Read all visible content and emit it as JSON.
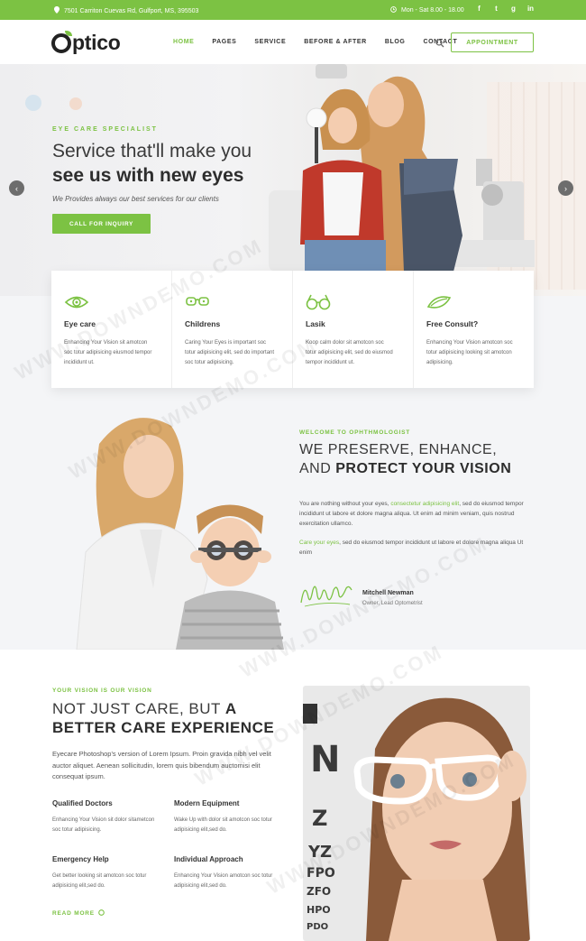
{
  "topbar": {
    "address": "7501 Carriton Cuevas Rd, Gulfport, MS, 395503",
    "hours": "Mon - Sat 8.00 - 18.00",
    "socials": [
      "f",
      "t",
      "g",
      "in"
    ]
  },
  "header": {
    "logo_text": "ptico",
    "nav": [
      "HOME",
      "PAGES",
      "SERVICE",
      "BEFORE & AFTER",
      "BLOG",
      "CONTACT"
    ],
    "active_nav": "HOME",
    "appointment_label": "APPOINTMENT"
  },
  "hero": {
    "kicker": "EYE CARE SPECIALIST",
    "title_line1": "Service that'll make you",
    "title_line2": "see us with new eyes",
    "subtitle": "We Provides always our best services for our clients",
    "button_label": "CALL FOR INQUIRY",
    "prev_glyph": "‹",
    "next_glyph": "›"
  },
  "services": [
    {
      "title": "Eye care",
      "desc": "Enhancing Your Vision sit amotcon soc totur adipisicing eiusmod tempor incididunt ut.",
      "icon": "eye-icon"
    },
    {
      "title": "Childrens",
      "desc": "Caring Your Eyes is important soc totur adipisicing elit, sed do important soc totur adipisicing.",
      "icon": "kids-glasses-icon"
    },
    {
      "title": "Lasik",
      "desc": "Koop calm dolor sit amotcon soc totur adipisicing elit, sed do eiusmod tempor incididunt ut.",
      "icon": "glasses-icon"
    },
    {
      "title": "Free Consult?",
      "desc": "Enhancing Your Vision amotcon soc totur adipisicing looking sit amotcon adipisicing.",
      "icon": "contact-lens-icon"
    }
  ],
  "about": {
    "kicker": "WELCOME TO OPHTHMOLOGIST",
    "heading_line1": "WE PRESERVE, ENHANCE,",
    "heading_line2_prefix": "AND ",
    "heading_line2_bold": "PROTECT YOUR VISION",
    "p1_prefix": "You are nothing without your eyes, ",
    "p1_link": "consectetur adipisicing elit",
    "p1_suffix": ", sed do eiusmod tempor incididunt ut labore et dolore magna aliqua. Ut enim ad minim veniam, quis nostrud exercitation ullamco.",
    "p2_link": "Care your eyes",
    "p2_suffix": ", sed do eiusmod tempor incididunt ut labore et dolore magna aliqua Ut enim",
    "sig_name": "Mitchell Newman",
    "sig_role": "Owner, Lead Optometrist"
  },
  "vision": {
    "kicker": "YOUR VISION IS OUR VISION",
    "heading_line1": "NOT JUST CARE, BUT ",
    "heading_line1_bold": "A",
    "heading_line2": "BETTER CARE EXPERIENCE",
    "paragraph": "Eyecare Photoshop's version of Lorem Ipsum. Proin gravida nibh vel velit auctor aliquet. Aenean sollicitudin, lorem quis bibendum auctomisi elit consequat ipsum.",
    "features": [
      {
        "title": "Qualified Doctors",
        "desc": "Enhancing Your Vision sit dolor sitametcon soc totur adipisicing."
      },
      {
        "title": "Modern Equipment",
        "desc": "Wake Up with dolor sit amotcon soc totur adipisicing elit,sed do."
      },
      {
        "title": "Emergency Help",
        "desc": "Get better looking sit amotcon soc totur adipisicing elit,sed do."
      },
      {
        "title": "Individual Approach",
        "desc": "Enhancing Your Vision amotcon soc totur adipisicing elit,sed do."
      }
    ],
    "read_more": "READ MORE"
  },
  "watermark": "WWW.DOWNDEMO.COM",
  "colors": {
    "accent": "#7cc243",
    "dark": "#2d2d2d",
    "band": "#f4f5f7"
  }
}
